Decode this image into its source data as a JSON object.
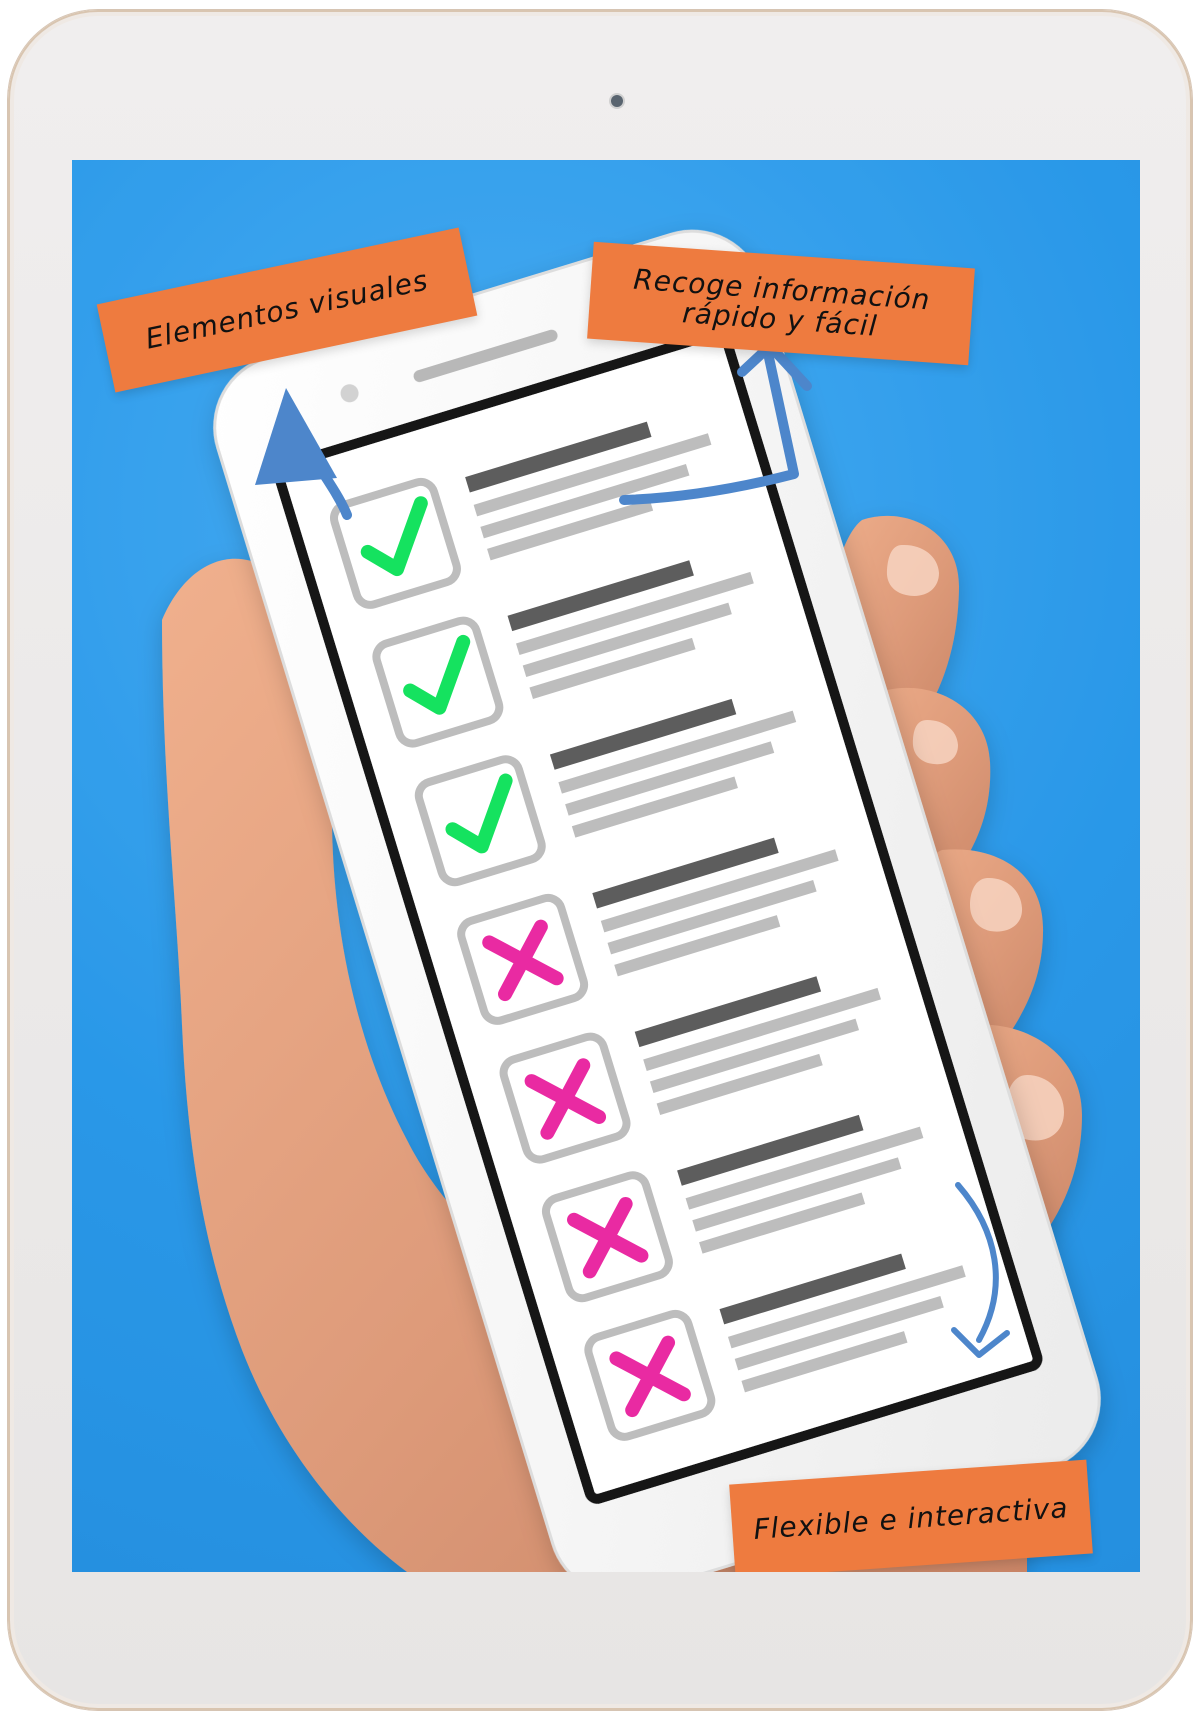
{
  "colors": {
    "background_blue": "#1c8fe3",
    "note_orange": "#ee7b3f",
    "arrow_blue": "#4d86cb",
    "check_green": "#15e25f",
    "cross_magenta": "#e92aa2",
    "skin": "#e2a17f",
    "phone_white": "#f5f5f5",
    "screen_white": "#ffffff",
    "text_dark_gray": "#5d5d5d",
    "text_light_gray": "#bdbdbd"
  },
  "icons": [
    "camera-icon",
    "check-icon",
    "cross-icon",
    "arrow-icon"
  ],
  "notes": {
    "left": "Elementos visuales",
    "top_right": "Recoge información\nrápido y fácil",
    "bottom_right": "Flexible e interactiva"
  },
  "checklist": [
    {
      "state": "checked"
    },
    {
      "state": "checked"
    },
    {
      "state": "checked"
    },
    {
      "state": "crossed"
    },
    {
      "state": "crossed"
    },
    {
      "state": "crossed"
    },
    {
      "state": "crossed"
    }
  ]
}
